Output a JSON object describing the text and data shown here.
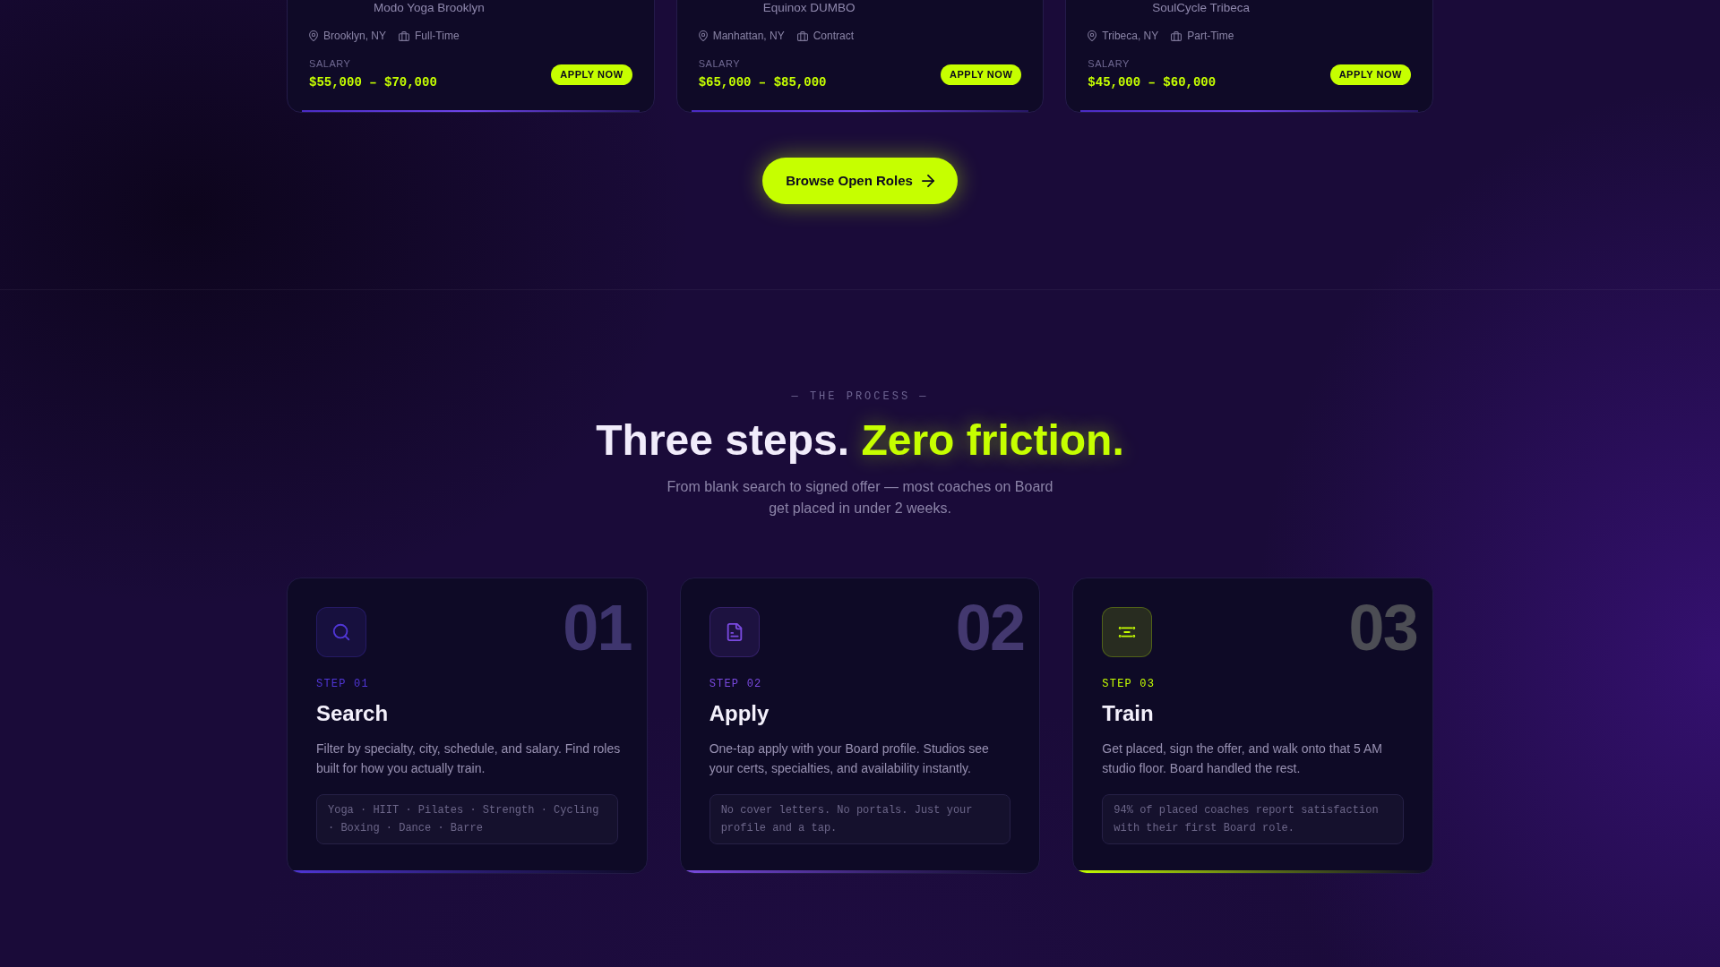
{
  "jobs": [
    {
      "company": "Modo Yoga Brooklyn",
      "location": "Brooklyn, NY",
      "type": "Full-Time",
      "salary_label": "SALARY",
      "salary": "$55,000 – $70,000",
      "button": "APPLY NOW"
    },
    {
      "company": "Equinox DUMBO",
      "location": "Manhattan, NY",
      "type": "Contract",
      "salary_label": "SALARY",
      "salary": "$65,000 – $85,000",
      "button": "APPLY NOW"
    },
    {
      "company": "SoulCycle Tribeca",
      "location": "Tribeca, NY",
      "type": "Part-Time",
      "salary_label": "SALARY",
      "salary": "$45,000 – $60,000",
      "button": "APPLY NOW"
    }
  ],
  "browse_button": {
    "label": "Browse Open Roles"
  },
  "process": {
    "eyebrow": "— THE PROCESS —",
    "title": "Three steps.",
    "title_highlight": "Zero friction.",
    "subtitle": "From blank search to signed offer — most coaches on Board get placed in under 2 weeks.",
    "steps": [
      {
        "number": "01",
        "label": "STEP 01",
        "title": "Search",
        "description": "Filter by specialty, city, schedule, and salary. Find roles built for how you actually train.",
        "note": "Yoga · HIIT · Pilates · Strength · Cycling · Boxing · Dance · Barre",
        "color": "#5036d6"
      },
      {
        "number": "02",
        "label": "STEP 02",
        "title": "Apply",
        "description": "One-tap apply with your Board profile. Studios see your certs, specialties, and availability instantly.",
        "note": "No cover letters. No portals. Just your profile and a tap.",
        "color": "#7a4ae0"
      },
      {
        "number": "03",
        "label": "STEP 03",
        "title": "Train",
        "description": "Get placed, sign the offer, and walk onto that 5 AM studio floor. Board handled the rest.",
        "note": "94% of placed coaches report satisfaction with their first Board role.",
        "color": "#c6ff00"
      }
    ]
  }
}
